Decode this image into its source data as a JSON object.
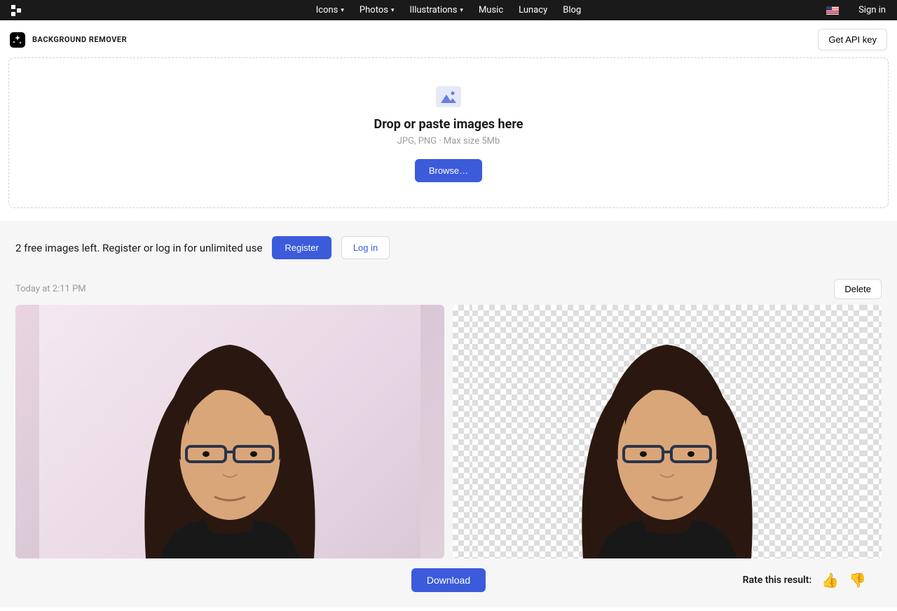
{
  "nav": {
    "items": [
      "Icons",
      "Photos",
      "Illustrations",
      "Music",
      "Lunacy",
      "Blog"
    ],
    "signin": "Sign in"
  },
  "subheader": {
    "title": "BACKGROUND REMOVER",
    "api_button": "Get API key"
  },
  "dropzone": {
    "title": "Drop or paste images here",
    "subtitle": "JPG, PNG · Max size 5Mb",
    "browse": "Browse…"
  },
  "free_bar": {
    "text": "2 free images left. Register or log in for unlimited use",
    "register": "Register",
    "login": "Log in"
  },
  "result": {
    "timestamp": "Today at 2:11 PM",
    "delete": "Delete",
    "download": "Download",
    "rate_label": "Rate this result:"
  }
}
